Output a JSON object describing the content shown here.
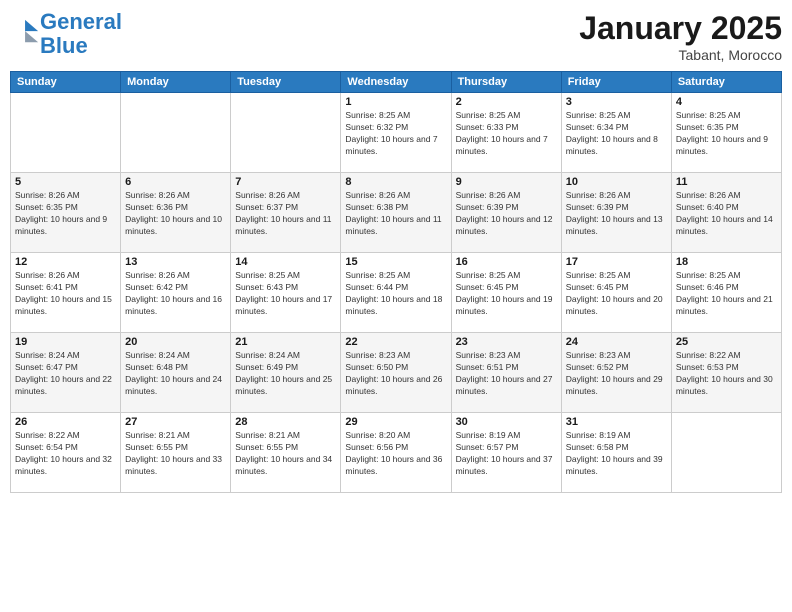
{
  "logo": {
    "line1": "General",
    "line2": "Blue"
  },
  "header": {
    "month": "January 2025",
    "location": "Tabant, Morocco"
  },
  "weekdays": [
    "Sunday",
    "Monday",
    "Tuesday",
    "Wednesday",
    "Thursday",
    "Friday",
    "Saturday"
  ],
  "weeks": [
    [
      {
        "day": "",
        "sunrise": "",
        "sunset": "",
        "daylight": ""
      },
      {
        "day": "",
        "sunrise": "",
        "sunset": "",
        "daylight": ""
      },
      {
        "day": "",
        "sunrise": "",
        "sunset": "",
        "daylight": ""
      },
      {
        "day": "1",
        "sunrise": "Sunrise: 8:25 AM",
        "sunset": "Sunset: 6:32 PM",
        "daylight": "Daylight: 10 hours and 7 minutes."
      },
      {
        "day": "2",
        "sunrise": "Sunrise: 8:25 AM",
        "sunset": "Sunset: 6:33 PM",
        "daylight": "Daylight: 10 hours and 7 minutes."
      },
      {
        "day": "3",
        "sunrise": "Sunrise: 8:25 AM",
        "sunset": "Sunset: 6:34 PM",
        "daylight": "Daylight: 10 hours and 8 minutes."
      },
      {
        "day": "4",
        "sunrise": "Sunrise: 8:25 AM",
        "sunset": "Sunset: 6:35 PM",
        "daylight": "Daylight: 10 hours and 9 minutes."
      }
    ],
    [
      {
        "day": "5",
        "sunrise": "Sunrise: 8:26 AM",
        "sunset": "Sunset: 6:35 PM",
        "daylight": "Daylight: 10 hours and 9 minutes."
      },
      {
        "day": "6",
        "sunrise": "Sunrise: 8:26 AM",
        "sunset": "Sunset: 6:36 PM",
        "daylight": "Daylight: 10 hours and 10 minutes."
      },
      {
        "day": "7",
        "sunrise": "Sunrise: 8:26 AM",
        "sunset": "Sunset: 6:37 PM",
        "daylight": "Daylight: 10 hours and 11 minutes."
      },
      {
        "day": "8",
        "sunrise": "Sunrise: 8:26 AM",
        "sunset": "Sunset: 6:38 PM",
        "daylight": "Daylight: 10 hours and 11 minutes."
      },
      {
        "day": "9",
        "sunrise": "Sunrise: 8:26 AM",
        "sunset": "Sunset: 6:39 PM",
        "daylight": "Daylight: 10 hours and 12 minutes."
      },
      {
        "day": "10",
        "sunrise": "Sunrise: 8:26 AM",
        "sunset": "Sunset: 6:39 PM",
        "daylight": "Daylight: 10 hours and 13 minutes."
      },
      {
        "day": "11",
        "sunrise": "Sunrise: 8:26 AM",
        "sunset": "Sunset: 6:40 PM",
        "daylight": "Daylight: 10 hours and 14 minutes."
      }
    ],
    [
      {
        "day": "12",
        "sunrise": "Sunrise: 8:26 AM",
        "sunset": "Sunset: 6:41 PM",
        "daylight": "Daylight: 10 hours and 15 minutes."
      },
      {
        "day": "13",
        "sunrise": "Sunrise: 8:26 AM",
        "sunset": "Sunset: 6:42 PM",
        "daylight": "Daylight: 10 hours and 16 minutes."
      },
      {
        "day": "14",
        "sunrise": "Sunrise: 8:25 AM",
        "sunset": "Sunset: 6:43 PM",
        "daylight": "Daylight: 10 hours and 17 minutes."
      },
      {
        "day": "15",
        "sunrise": "Sunrise: 8:25 AM",
        "sunset": "Sunset: 6:44 PM",
        "daylight": "Daylight: 10 hours and 18 minutes."
      },
      {
        "day": "16",
        "sunrise": "Sunrise: 8:25 AM",
        "sunset": "Sunset: 6:45 PM",
        "daylight": "Daylight: 10 hours and 19 minutes."
      },
      {
        "day": "17",
        "sunrise": "Sunrise: 8:25 AM",
        "sunset": "Sunset: 6:45 PM",
        "daylight": "Daylight: 10 hours and 20 minutes."
      },
      {
        "day": "18",
        "sunrise": "Sunrise: 8:25 AM",
        "sunset": "Sunset: 6:46 PM",
        "daylight": "Daylight: 10 hours and 21 minutes."
      }
    ],
    [
      {
        "day": "19",
        "sunrise": "Sunrise: 8:24 AM",
        "sunset": "Sunset: 6:47 PM",
        "daylight": "Daylight: 10 hours and 22 minutes."
      },
      {
        "day": "20",
        "sunrise": "Sunrise: 8:24 AM",
        "sunset": "Sunset: 6:48 PM",
        "daylight": "Daylight: 10 hours and 24 minutes."
      },
      {
        "day": "21",
        "sunrise": "Sunrise: 8:24 AM",
        "sunset": "Sunset: 6:49 PM",
        "daylight": "Daylight: 10 hours and 25 minutes."
      },
      {
        "day": "22",
        "sunrise": "Sunrise: 8:23 AM",
        "sunset": "Sunset: 6:50 PM",
        "daylight": "Daylight: 10 hours and 26 minutes."
      },
      {
        "day": "23",
        "sunrise": "Sunrise: 8:23 AM",
        "sunset": "Sunset: 6:51 PM",
        "daylight": "Daylight: 10 hours and 27 minutes."
      },
      {
        "day": "24",
        "sunrise": "Sunrise: 8:23 AM",
        "sunset": "Sunset: 6:52 PM",
        "daylight": "Daylight: 10 hours and 29 minutes."
      },
      {
        "day": "25",
        "sunrise": "Sunrise: 8:22 AM",
        "sunset": "Sunset: 6:53 PM",
        "daylight": "Daylight: 10 hours and 30 minutes."
      }
    ],
    [
      {
        "day": "26",
        "sunrise": "Sunrise: 8:22 AM",
        "sunset": "Sunset: 6:54 PM",
        "daylight": "Daylight: 10 hours and 32 minutes."
      },
      {
        "day": "27",
        "sunrise": "Sunrise: 8:21 AM",
        "sunset": "Sunset: 6:55 PM",
        "daylight": "Daylight: 10 hours and 33 minutes."
      },
      {
        "day": "28",
        "sunrise": "Sunrise: 8:21 AM",
        "sunset": "Sunset: 6:55 PM",
        "daylight": "Daylight: 10 hours and 34 minutes."
      },
      {
        "day": "29",
        "sunrise": "Sunrise: 8:20 AM",
        "sunset": "Sunset: 6:56 PM",
        "daylight": "Daylight: 10 hours and 36 minutes."
      },
      {
        "day": "30",
        "sunrise": "Sunrise: 8:19 AM",
        "sunset": "Sunset: 6:57 PM",
        "daylight": "Daylight: 10 hours and 37 minutes."
      },
      {
        "day": "31",
        "sunrise": "Sunrise: 8:19 AM",
        "sunset": "Sunset: 6:58 PM",
        "daylight": "Daylight: 10 hours and 39 minutes."
      },
      {
        "day": "",
        "sunrise": "",
        "sunset": "",
        "daylight": ""
      }
    ]
  ]
}
